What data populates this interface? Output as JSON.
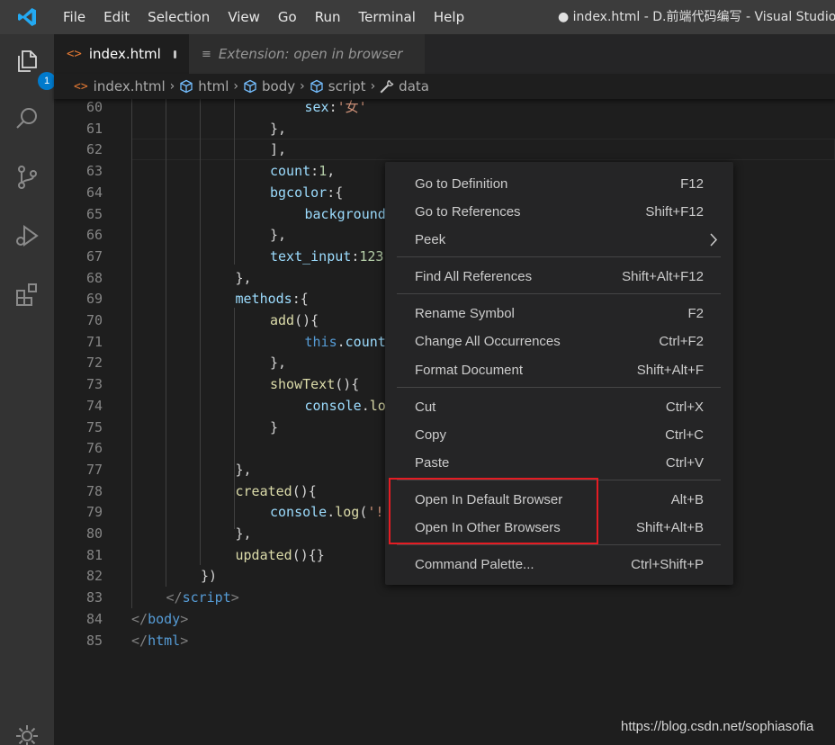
{
  "menubar": [
    "File",
    "Edit",
    "Selection",
    "View",
    "Go",
    "Run",
    "Terminal",
    "Help"
  ],
  "window_title": "● index.html - D.前端代码编写 - Visual Studio Code",
  "activity": {
    "explorer_badge": "1"
  },
  "tabs": [
    {
      "label": "index.html",
      "active": true,
      "dirty": true
    },
    {
      "label": "Extension: open in browser",
      "active": false
    }
  ],
  "breadcrumb": [
    "index.html",
    "html",
    "body",
    "script",
    "data"
  ],
  "code_lines": [
    {
      "n": "60",
      "html": "<span class='k'>sex</span><span class='p'>:</span><span class='s'>'女'</span>",
      "indent": 5
    },
    {
      "n": "61",
      "html": "<span class='p'>},</span>",
      "indent": 4
    },
    {
      "n": "62",
      "html": "<span class='p'>],</span>",
      "indent": 4
    },
    {
      "n": "63",
      "html": "<span class='k'>count</span><span class='p'>:</span><span class='n'>1</span><span class='p'>,</span>",
      "indent": 4
    },
    {
      "n": "64",
      "html": "<span class='k'>bgcolor</span><span class='p'>:{</span>",
      "indent": 4
    },
    {
      "n": "65",
      "html": "<span class='k'>background</span>",
      "indent": 5
    },
    {
      "n": "66",
      "html": "<span class='p'>},</span>",
      "indent": 4
    },
    {
      "n": "67",
      "html": "<span class='k'>text_input</span><span class='p'>:</span><span class='n'>123</span>",
      "indent": 4
    },
    {
      "n": "68",
      "html": "<span class='p'>},</span>",
      "indent": 3
    },
    {
      "n": "69",
      "html": "<span class='k'>methods</span><span class='p'>:{</span>",
      "indent": 3
    },
    {
      "n": "70",
      "html": "<span class='f'>add</span><span class='p'>(){</span>",
      "indent": 4
    },
    {
      "n": "71",
      "html": "<span class='kw'>this</span><span class='p'>.</span><span class='k'>count</span>",
      "indent": 5
    },
    {
      "n": "72",
      "html": "<span class='p'>},</span>",
      "indent": 4
    },
    {
      "n": "73",
      "html": "<span class='f'>showText</span><span class='p'>(){</span>",
      "indent": 4
    },
    {
      "n": "74",
      "html": "<span class='k'>console</span><span class='p'>.</span><span class='f'>lo</span>",
      "indent": 5
    },
    {
      "n": "75",
      "html": "<span class='p'>}</span>",
      "indent": 4
    },
    {
      "n": "76",
      "html": "",
      "indent": 0
    },
    {
      "n": "77",
      "html": "<span class='p'>},</span>",
      "indent": 3
    },
    {
      "n": "78",
      "html": "<span class='f'>created</span><span class='p'>(){</span>",
      "indent": 3
    },
    {
      "n": "79",
      "html": "<span class='k'>console</span><span class='p'>.</span><span class='f'>log</span><span class='p'>(</span><span class='s'>'!</span>",
      "indent": 4
    },
    {
      "n": "80",
      "html": "<span class='p'>},</span>",
      "indent": 3
    },
    {
      "n": "81",
      "html": "<span class='f'>updated</span><span class='p'>(){}</span>",
      "indent": 3
    },
    {
      "n": "82",
      "html": "<span class='p'>})</span>",
      "indent": 2
    },
    {
      "n": "83",
      "html": "<span class='tg'>&lt;/</span><span class='t'>script</span><span class='tg'>&gt;</span>",
      "indent": 1
    },
    {
      "n": "84",
      "html": "<span class='tg'>&lt;/</span><span class='t'>body</span><span class='tg'>&gt;</span>",
      "indent": 0
    },
    {
      "n": "85",
      "html": "<span class='tg'>&lt;/</span><span class='t'>html</span><span class='tg'>&gt;</span>",
      "indent": 0
    }
  ],
  "context_menu": {
    "items": [
      {
        "label": "Go to Definition",
        "key": "F12"
      },
      {
        "label": "Go to References",
        "key": "Shift+F12"
      },
      {
        "label": "Peek",
        "key": "",
        "submenu": true
      },
      {
        "label": "Find All References",
        "key": "Shift+Alt+F12"
      },
      {
        "label": "Rename Symbol",
        "key": "F2"
      },
      {
        "label": "Change All Occurrences",
        "key": "Ctrl+F2"
      },
      {
        "label": "Format Document",
        "key": "Shift+Alt+F"
      },
      {
        "label": "Cut",
        "key": "Ctrl+X"
      },
      {
        "label": "Copy",
        "key": "Ctrl+C"
      },
      {
        "label": "Paste",
        "key": "Ctrl+V"
      },
      {
        "label": "Open In Default Browser",
        "key": "Alt+B"
      },
      {
        "label": "Open In Other Browsers",
        "key": "Shift+Alt+B"
      },
      {
        "label": "Command Palette...",
        "key": "Ctrl+Shift+P"
      }
    ]
  },
  "watermark": "https://blog.csdn.net/sophiasofia",
  "colors": {
    "accent": "#007acc",
    "highlight_box": "#e51c23"
  }
}
